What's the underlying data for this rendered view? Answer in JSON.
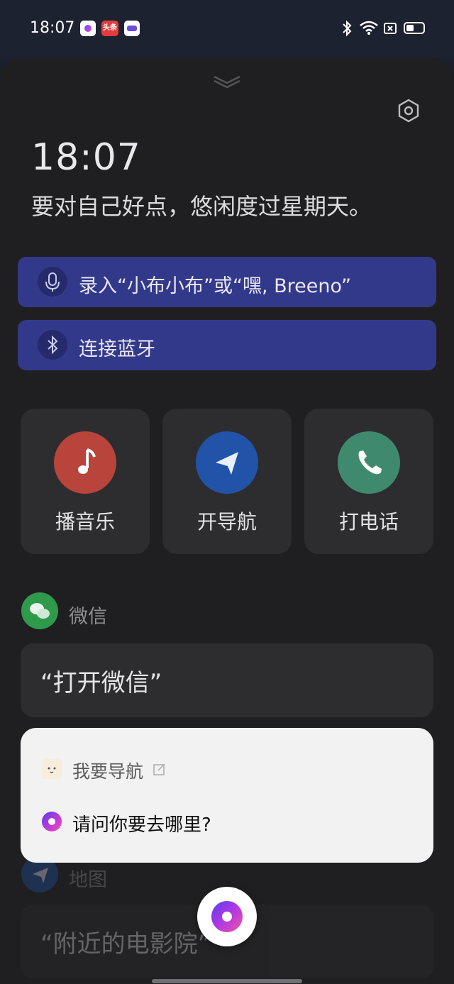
{
  "status_bar": {
    "time": "18:07",
    "news_badge": "头条",
    "app_icons": [
      "assistant-icon",
      "news-icon",
      "car-icon"
    ],
    "right_icons": [
      "bluetooth-icon",
      "wifi-icon",
      "no-sim-icon",
      "battery-icon"
    ]
  },
  "header": {
    "time": "18:07",
    "greeting": "要对自己好点，悠闲度过星期天。"
  },
  "prompts": {
    "wake_label": "录入“小布小布”或“嘿, Breeno”",
    "bluetooth_label": "连接蓝牙"
  },
  "actions": [
    {
      "label": "播音乐",
      "icon": "music-note-icon",
      "color": "#b8443c"
    },
    {
      "label": "开导航",
      "icon": "navigation-arrow-icon",
      "color": "#2154a8"
    },
    {
      "label": "打电话",
      "icon": "phone-icon",
      "color": "#3f8a6e"
    }
  ],
  "suggestions": [
    {
      "app": "微信",
      "quote": "“打开微信”"
    },
    {
      "app": "地图",
      "quote": "“附近的电影院”"
    }
  ],
  "dialog": {
    "user_utterance": "我要导航",
    "assistant_reply": "请问你要去哪里?"
  },
  "colors": {
    "accent_pill": "#33398a",
    "background": "#1f1f21"
  }
}
